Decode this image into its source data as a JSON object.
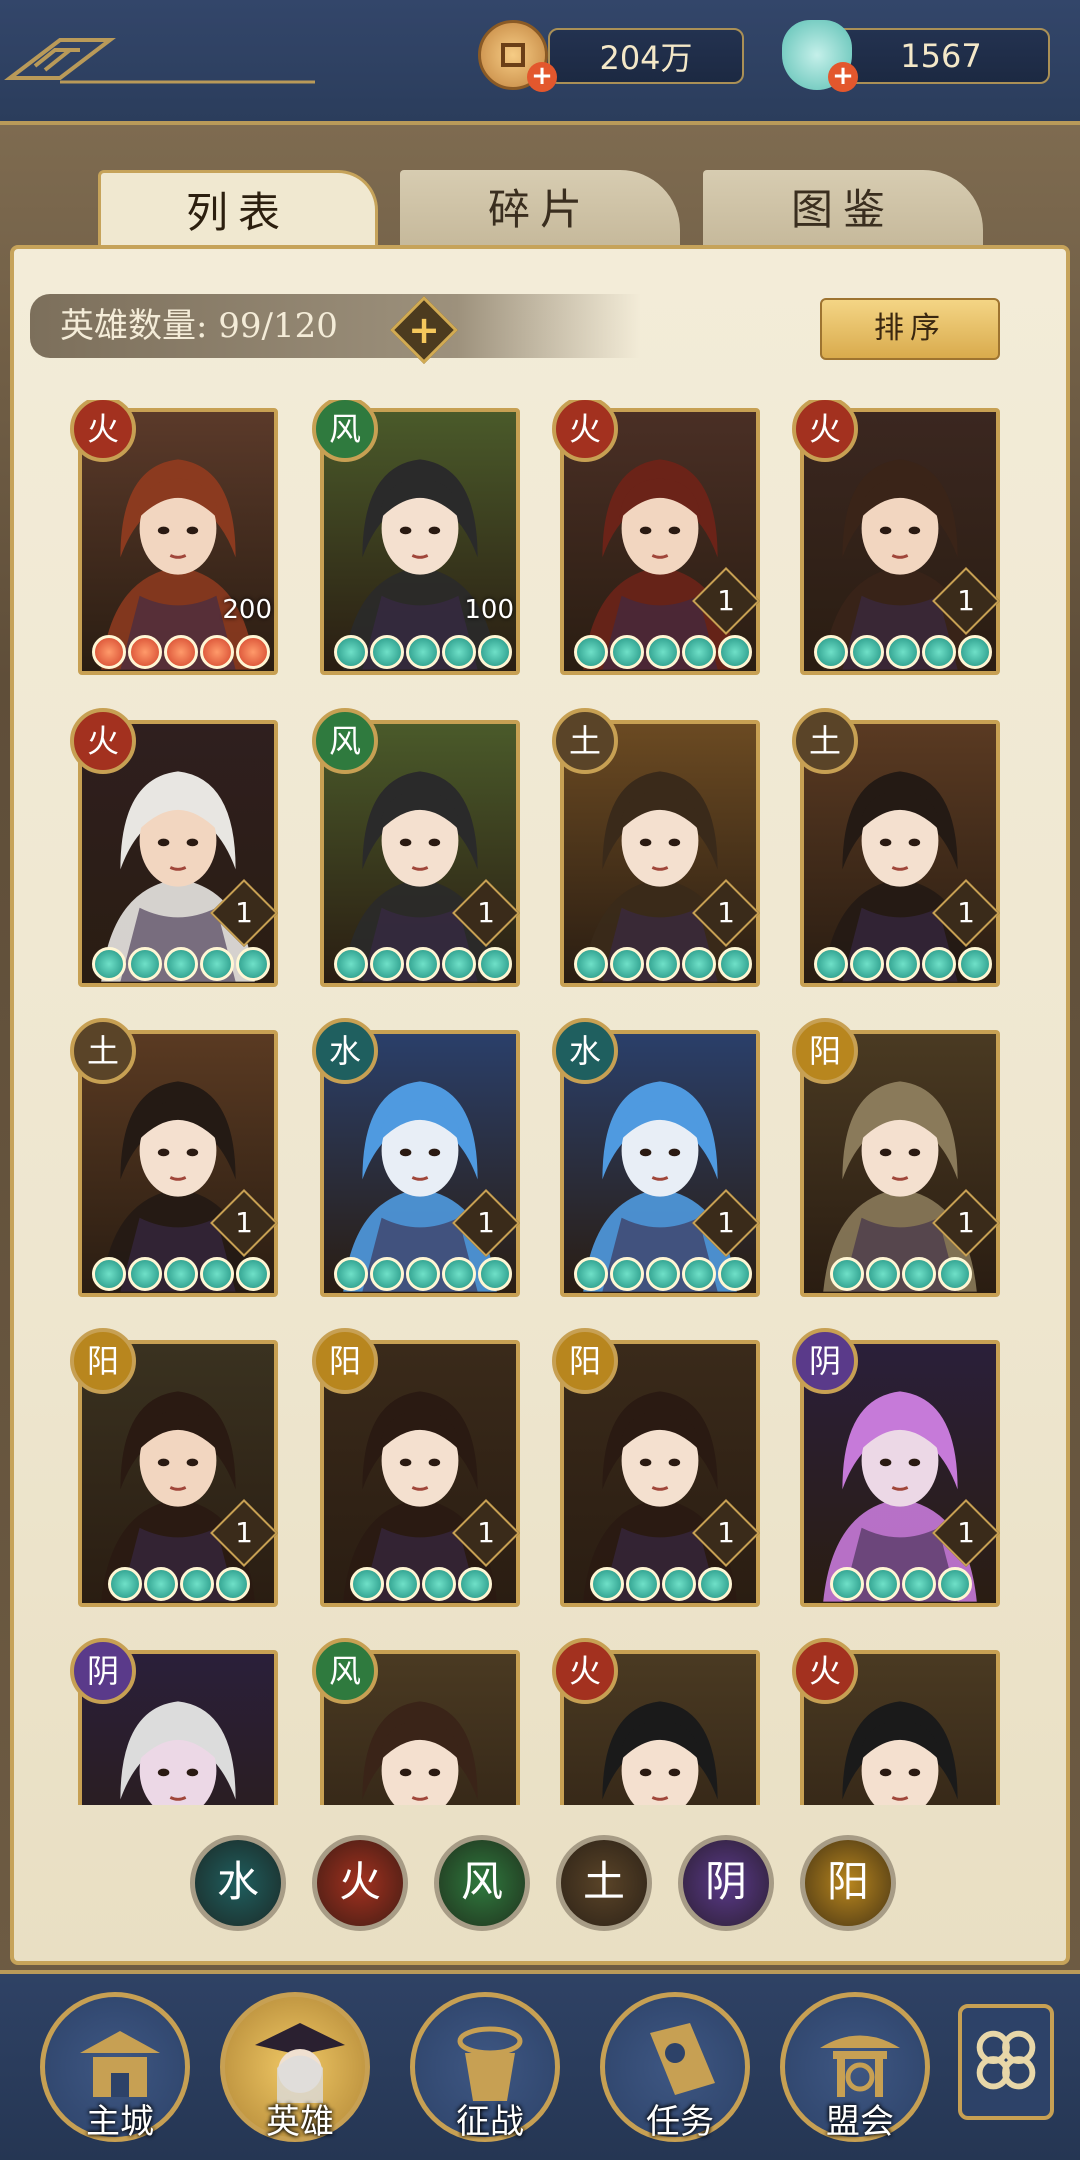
{
  "currency": {
    "coins": "204万",
    "jade": "1567",
    "add_symbol": "+"
  },
  "tabs": [
    "列表",
    "碎片",
    "图鉴"
  ],
  "hero_count_label": "英雄数量: 99/120",
  "add_symbol": "+",
  "sort_label": "排序",
  "heroes": [
    {
      "element": "火",
      "level": "200",
      "stars": 5,
      "star_color": "#d2422b",
      "bg": "#5b3a2a",
      "hair": "#8b3a1f",
      "skin": "#f2d6c0"
    },
    {
      "element": "风",
      "level": "100",
      "stars": 5,
      "star_color": "#1f8f7f",
      "bg": "#4a5a2a",
      "hair": "#2a2a2a",
      "skin": "#f4e0cf"
    },
    {
      "element": "火",
      "level": "1",
      "stars": 5,
      "star_color": "#1f8f7f",
      "bg": "#4a2f25",
      "hair": "#6b2318",
      "skin": "#f2d6c0"
    },
    {
      "element": "火",
      "level": "1",
      "stars": 5,
      "star_color": "#1f8f7f",
      "bg": "#3b2720",
      "hair": "#3a2418",
      "skin": "#f2d6c0"
    },
    {
      "element": "火",
      "level": "1",
      "stars": 5,
      "star_color": "#1f8f7f",
      "bg": "#2f1f1f",
      "hair": "#e8e6e2",
      "skin": "#f2d6c0"
    },
    {
      "element": "风",
      "level": "1",
      "stars": 5,
      "star_color": "#1f8f7f",
      "bg": "#4a5a2a",
      "hair": "#2a2a2a",
      "skin": "#f4e0cf"
    },
    {
      "element": "土",
      "level": "1",
      "stars": 5,
      "star_color": "#1f8f7f",
      "bg": "#6b4a22",
      "hair": "#3a2a1a",
      "skin": "#f4e0cf"
    },
    {
      "element": "土",
      "level": "1",
      "stars": 5,
      "star_color": "#1f8f7f",
      "bg": "#5a3a22",
      "hair": "#241a14",
      "skin": "#f4e0cf"
    },
    {
      "element": "土",
      "level": "1",
      "stars": 5,
      "star_color": "#1f8f7f",
      "bg": "#5a3a22",
      "hair": "#241a14",
      "skin": "#f4e0cf"
    },
    {
      "element": "水",
      "level": "1",
      "stars": 5,
      "star_color": "#1f8f7f",
      "bg": "#2a3f6a",
      "hair": "#4f9ae0",
      "skin": "#e8eef6"
    },
    {
      "element": "水",
      "level": "1",
      "stars": 5,
      "star_color": "#1f8f7f",
      "bg": "#2a3f6a",
      "hair": "#4f9ae0",
      "skin": "#e8eef6"
    },
    {
      "element": "阳",
      "level": "1",
      "stars": 4,
      "star_color": "#1f8f7f",
      "bg": "#4a3a22",
      "hair": "#8a7a5a",
      "skin": "#f4e0cf"
    },
    {
      "element": "阳",
      "level": "1",
      "stars": 4,
      "star_color": "#1f8f7f",
      "bg": "#3a3220",
      "hair": "#2a1a12",
      "skin": "#f2d6c0"
    },
    {
      "element": "阳",
      "level": "1",
      "stars": 4,
      "star_color": "#1f8f7f",
      "bg": "#3a2a1a",
      "hair": "#2a1a12",
      "skin": "#f4e0cf"
    },
    {
      "element": "阳",
      "level": "1",
      "stars": 4,
      "star_color": "#1f8f7f",
      "bg": "#3a2a1a",
      "hair": "#2a1a12",
      "skin": "#f4e0cf"
    },
    {
      "element": "阴",
      "level": "1",
      "stars": 4,
      "star_color": "#1f8f7f",
      "bg": "#2a1f3a",
      "hair": "#c67ad9",
      "skin": "#ecd8e6"
    },
    {
      "element": "阴",
      "level": "",
      "stars": 0,
      "star_color": "#1f8f7f",
      "bg": "#2a1f3a",
      "hair": "#dcdcdc",
      "skin": "#ecd8e6"
    },
    {
      "element": "风",
      "level": "",
      "stars": 0,
      "star_color": "#1f8f7f",
      "bg": "#4a3a22",
      "hair": "#3a2418",
      "skin": "#f4e0cf"
    },
    {
      "element": "火",
      "level": "",
      "stars": 0,
      "star_color": "#1f8f7f",
      "bg": "#4a3a22",
      "hair": "#1a1a1a",
      "skin": "#f4e0cf"
    },
    {
      "element": "火",
      "level": "",
      "stars": 0,
      "star_color": "#1f8f7f",
      "bg": "#4a3a22",
      "hair": "#1a1a1a",
      "skin": "#f4e0cf"
    }
  ],
  "element_colors": {
    "火": "#a3311f",
    "风": "#2f7a3e",
    "土": "#5a4428",
    "水": "#1f5f5f",
    "阳": "#b8861e",
    "阴": "#5a3a8a"
  },
  "filters": [
    {
      "label": "水",
      "color": "#1f5f5f"
    },
    {
      "label": "火",
      "color": "#a3311f"
    },
    {
      "label": "风",
      "color": "#2f7a3e"
    },
    {
      "label": "土",
      "color": "#5a4428"
    },
    {
      "label": "阴",
      "color": "#5a3a8a"
    },
    {
      "label": "阳",
      "color": "#b8861e"
    }
  ],
  "nav": [
    "主城",
    "英雄",
    "征战",
    "任务",
    "盟会"
  ]
}
